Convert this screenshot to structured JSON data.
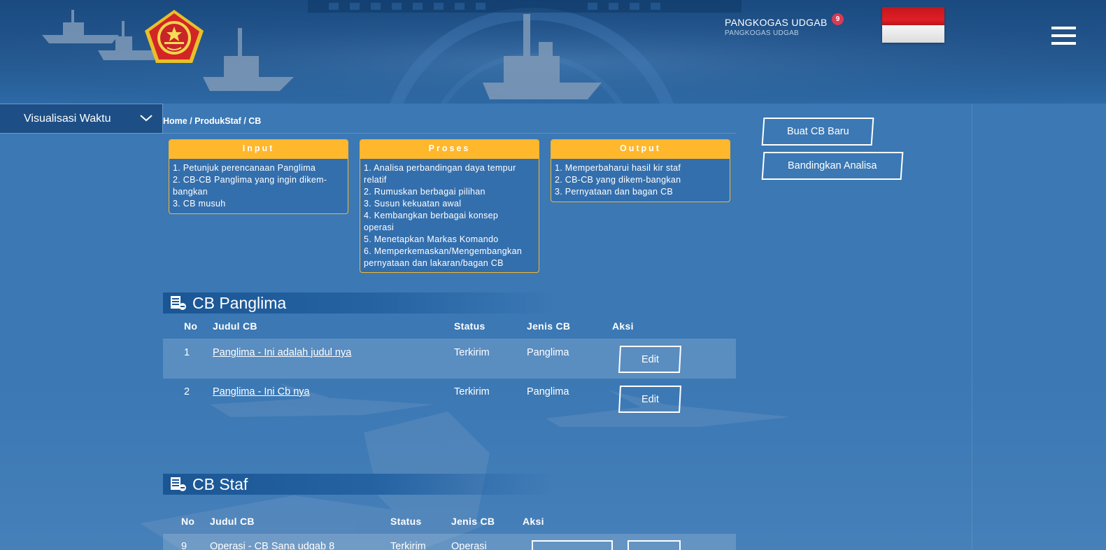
{
  "header": {
    "user_name": "PANGKOGAS UDGAB",
    "user_role": "PANGKOGAS UDGAB",
    "notification_count": "9",
    "flag_colors": [
      "#e01e25",
      "#f2f2f2"
    ]
  },
  "sidebar": {
    "dropdown_label": "Visualisasi Waktu"
  },
  "breadcrumb": {
    "items": [
      "Home",
      "ProdukStaf",
      "CB"
    ],
    "separator": " / "
  },
  "process": {
    "input": {
      "title": "Input",
      "lines": [
        "1. Petunjuk perencanaan Panglima",
        "2. CB-CB Panglima yang ingin dikem-",
        "bangkan",
        "3. CB musuh"
      ]
    },
    "proses": {
      "title": "Proses",
      "lines": [
        "1. Analisa perbandingan daya tempur",
        "relatif",
        "2. Rumuskan berbagai pilihan",
        "3. Susun kekuatan awal",
        "4. Kembangkan berbagai konsep",
        "operasi",
        "5. Menetapkan Markas Komando",
        "6. Memperkemaskan/Mengembangkan",
        "pernyataan dan lakaran/bagan CB"
      ]
    },
    "output": {
      "title": "Output",
      "lines": [
        "1. Memperbaharui hasil kir staf",
        "2. CB-CB yang dikem-bangkan",
        "3. Pernyataan dan bagan CB"
      ]
    }
  },
  "actions": {
    "new_cb": "Buat CB Baru",
    "compare": "Bandingkan Analisa"
  },
  "cb_panglima": {
    "title": "CB Panglima",
    "columns": [
      "No",
      "Judul CB",
      "Status",
      "Jenis CB",
      "Aksi"
    ],
    "rows": [
      {
        "no": "1",
        "judul": "Panglima - Ini adalah judul nya",
        "status": "Terkirim",
        "jenis": "Panglima",
        "aksi": "Edit"
      },
      {
        "no": "2",
        "judul": "Panglima - Ini Cb nya",
        "status": "Terkirim",
        "jenis": "Panglima",
        "aksi": "Edit"
      }
    ]
  },
  "cb_staf": {
    "title": "CB Staf",
    "columns": [
      "No",
      "Judul CB",
      "Status",
      "Jenis CB",
      "Aksi"
    ],
    "rows": [
      {
        "no": "9",
        "judul": "Operasi - CB Sana udgab 8",
        "status": "Terkirim",
        "jenis": "Operasi"
      }
    ]
  },
  "colors": {
    "accent_orange": "#ffb72c",
    "page_bg": "#3b78b4",
    "header_bg": "#1a4a80",
    "badge_red": "#d93a55"
  }
}
